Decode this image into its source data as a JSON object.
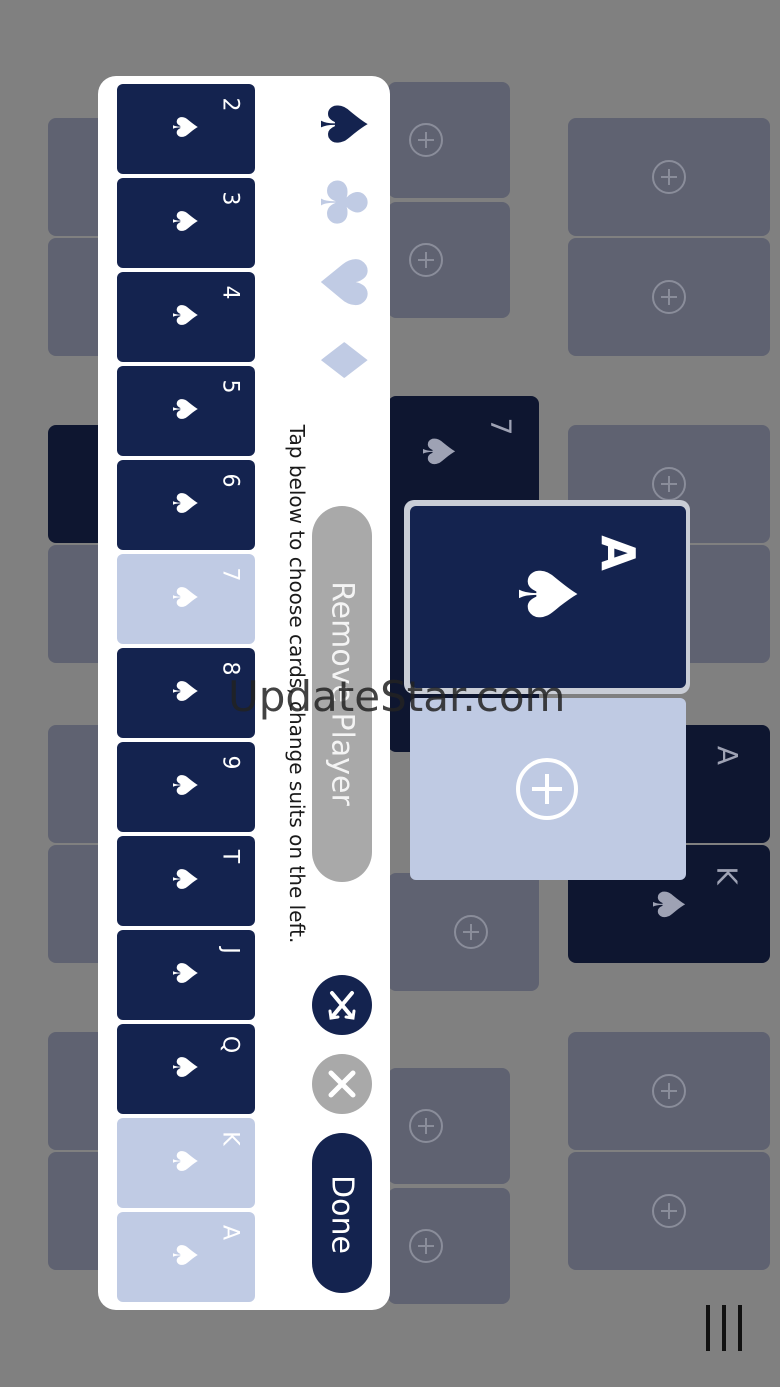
{
  "background_color": "#808080",
  "popup": {
    "suits": [
      {
        "name": "spades",
        "glyph": "♠",
        "color": "#14234f",
        "selected": true
      },
      {
        "name": "clubs",
        "glyph": "♣",
        "color": "#c0cbe4",
        "selected": false
      },
      {
        "name": "hearts",
        "glyph": "♥",
        "color": "#c0cbe4",
        "selected": false
      },
      {
        "name": "diamonds",
        "glyph": "♦",
        "color": "#c0cbe4",
        "selected": false
      }
    ],
    "instruction": "Tap below to choose cards, change suits on the left.",
    "remove_label": "Remove Player",
    "done_label": "Done",
    "shuffle_icon": "shuffle-icon",
    "close_icon": "close-icon",
    "cards": [
      {
        "rank": "2",
        "suit": "♠",
        "selected": false
      },
      {
        "rank": "3",
        "suit": "♠",
        "selected": false
      },
      {
        "rank": "4",
        "suit": "♠",
        "selected": false
      },
      {
        "rank": "5",
        "suit": "♠",
        "selected": false
      },
      {
        "rank": "6",
        "suit": "♠",
        "selected": false
      },
      {
        "rank": "7",
        "suit": "♠",
        "selected": true
      },
      {
        "rank": "8",
        "suit": "♠",
        "selected": false
      },
      {
        "rank": "9",
        "suit": "♠",
        "selected": false
      },
      {
        "rank": "T",
        "suit": "♠",
        "selected": false
      },
      {
        "rank": "J",
        "suit": "♠",
        "selected": false
      },
      {
        "rank": "Q",
        "suit": "♠",
        "selected": false
      },
      {
        "rank": "K",
        "suit": "♠",
        "selected": true
      },
      {
        "rank": "A",
        "suit": "♠",
        "selected": true
      }
    ]
  },
  "selected_card": {
    "rank": "A",
    "suit": "♠"
  },
  "table_cards": [
    {
      "rank": "7",
      "suit": "♠"
    },
    {
      "rank": "A",
      "suit": "♠"
    },
    {
      "rank": "K",
      "suit": "♠"
    }
  ],
  "watermark": "UpdateStar.com"
}
